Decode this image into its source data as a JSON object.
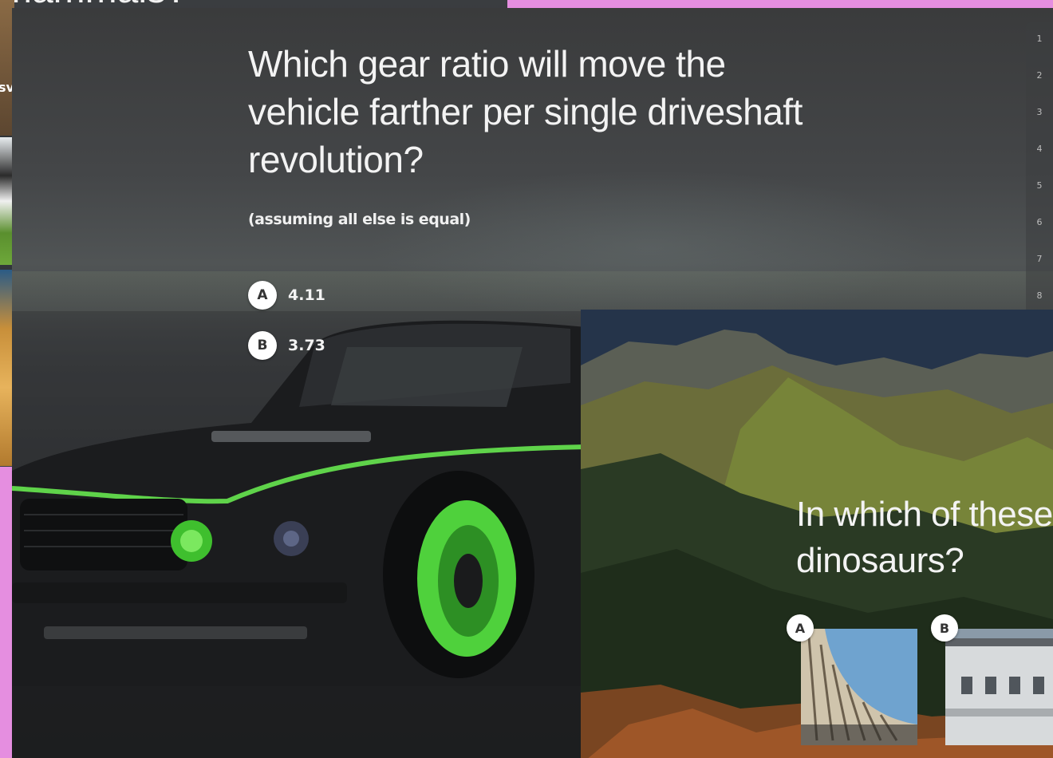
{
  "background_card": {
    "peek_title": "mammals?",
    "peek_label": "sv"
  },
  "main_question": {
    "title": "Which gear ratio will move the vehicle farther per single driveshaft revolution?",
    "subtitle": "(assuming all else is equal)",
    "answers": [
      {
        "letter": "A",
        "text": "4.11"
      },
      {
        "letter": "B",
        "text": "3.73"
      }
    ]
  },
  "question_nav": {
    "numbers": [
      "1",
      "2",
      "3",
      "4",
      "5",
      "6",
      "7",
      "8"
    ]
  },
  "dino_question": {
    "title_line1": "In which of these",
    "title_line2": "dinosaurs?",
    "options": [
      {
        "letter": "A"
      },
      {
        "letter": "B"
      }
    ]
  },
  "colors": {
    "page_background": "#e58ee0",
    "text_primary": "#f3f3f3",
    "badge_bg": "#ffffff",
    "accent_green": "#5fd34a"
  }
}
